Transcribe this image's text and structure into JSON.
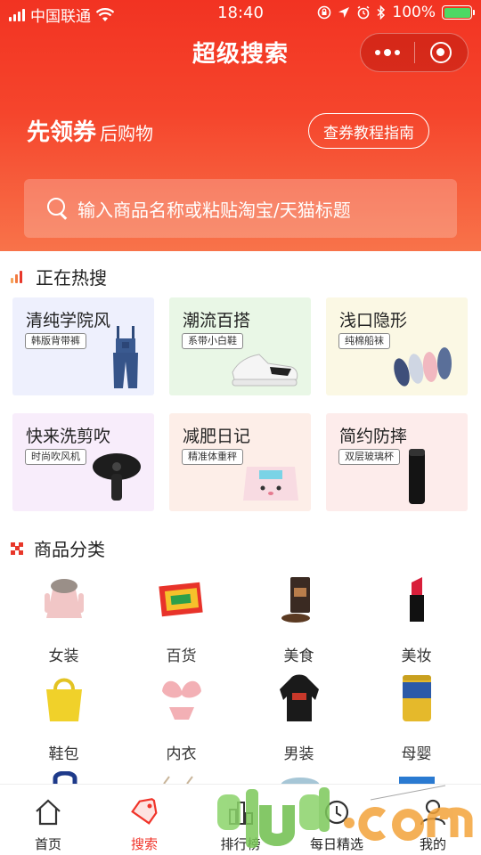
{
  "status_bar": {
    "carrier": "中国联通",
    "time": "18:40",
    "battery": "100%",
    "battery_level": 1.0
  },
  "nav": {
    "title": "超级搜索",
    "more_icon": "more-dots-icon",
    "close_icon": "target-icon"
  },
  "promo": {
    "slogan_strong": "先领券",
    "slogan_weak": "后购物",
    "guide_button": "查券教程指南"
  },
  "search": {
    "placeholder": "输入商品名称或粘贴淘宝/天猫标题"
  },
  "hot": {
    "section_title": "正在热搜",
    "cards": [
      {
        "title": "清纯学院风",
        "tag": "韩版背带裤",
        "bg": "#eef0fd"
      },
      {
        "title": "潮流百搭",
        "tag": "系带小白鞋",
        "bg": "#e9f7e6"
      },
      {
        "title": "浅口隐形",
        "tag": "纯棉船袜",
        "bg": "#fbf8e4"
      },
      {
        "title": "快来洗剪吹",
        "tag": "时尚吹风机",
        "bg": "#f8edfb"
      },
      {
        "title": "减肥日记",
        "tag": "精准体重秤",
        "bg": "#fdeee8"
      },
      {
        "title": "简约防摔",
        "tag": "双层玻璃杯",
        "bg": "#fdeceb"
      }
    ]
  },
  "categories": {
    "section_title": "商品分类",
    "items": [
      {
        "label": "女装"
      },
      {
        "label": "百货"
      },
      {
        "label": "美食"
      },
      {
        "label": "美妆"
      },
      {
        "label": "鞋包"
      },
      {
        "label": "内衣"
      },
      {
        "label": "男装"
      },
      {
        "label": "母婴"
      }
    ]
  },
  "tabbar": {
    "items": [
      {
        "label": "首页",
        "icon": "home-icon"
      },
      {
        "label": "搜索",
        "icon": "tag-icon"
      },
      {
        "label": "排行榜",
        "icon": "ranking-icon"
      },
      {
        "label": "每日精选",
        "icon": "daily-icon"
      },
      {
        "label": "我的",
        "icon": "user-icon"
      }
    ],
    "active_index": 1
  },
  "colors": {
    "brand_red": "#f0342a",
    "header_top": "#f23322",
    "header_bottom": "#f8734a"
  }
}
